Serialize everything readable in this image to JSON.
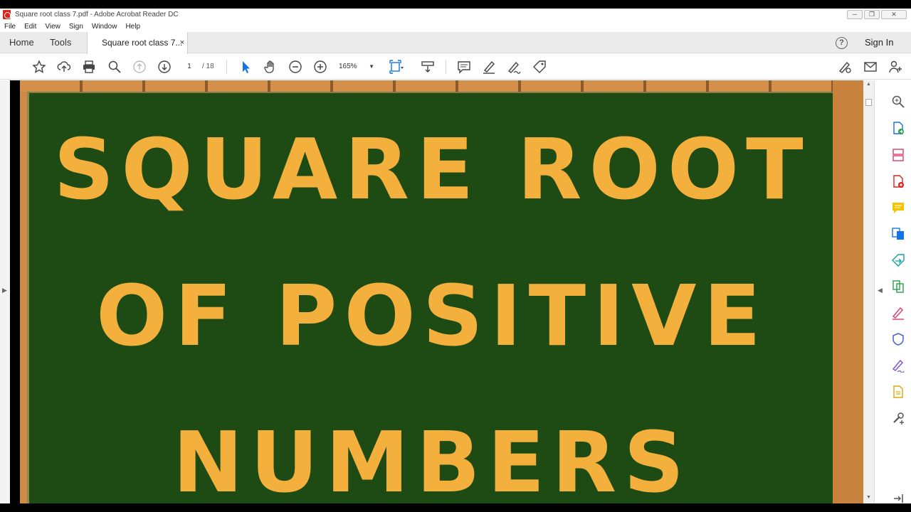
{
  "window": {
    "title": "Square root class 7.pdf - Adobe Acrobat Reader DC",
    "minimize": "─",
    "maximize": "❐",
    "close": "✕"
  },
  "menu": [
    "File",
    "Edit",
    "View",
    "Sign",
    "Window",
    "Help"
  ],
  "tabs": {
    "home": "Home",
    "tools": "Tools",
    "document": "Square root class 7...",
    "close": "×"
  },
  "header": {
    "help": "?",
    "sign_in": "Sign In"
  },
  "toolbar": {
    "page_current": "1",
    "page_total": "/ 18",
    "zoom": "165%",
    "zoom_caret": "▼"
  },
  "document": {
    "lines": [
      "SQUARE ROOT",
      "OF POSITIVE",
      "NUMBERS"
    ]
  },
  "panel_arrows": {
    "left": "▶",
    "right": "◀",
    "scroll_up": "▲",
    "scroll_down": "▼"
  },
  "colors": {
    "accent_blue": "#1473e6",
    "board_green": "#1e4b13",
    "letter_orange": "#f3b03c",
    "frame_wood": "#cf8a45"
  }
}
